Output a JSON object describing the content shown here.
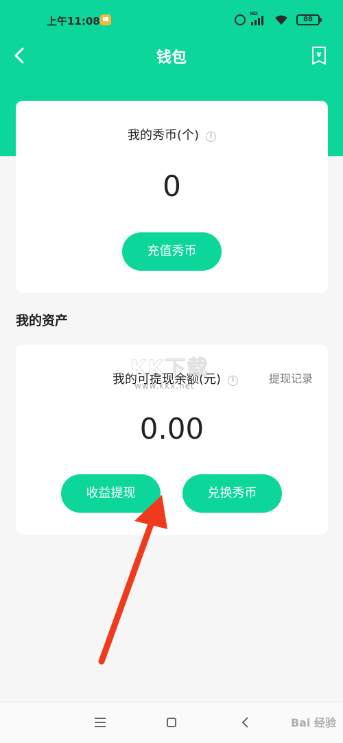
{
  "status_bar": {
    "time": "上午11:08",
    "hd": "HD",
    "battery": "88"
  },
  "header": {
    "title": "钱包",
    "back_icon": "chevron-left-icon",
    "bill_icon": "yuan-bill-icon"
  },
  "coin_card": {
    "title": "我的秀币(个)",
    "value": "0",
    "recharge_label": "充值秀币"
  },
  "assets": {
    "section_title": "我的资产",
    "balance_title": "我的可提现余额(元)",
    "record_link": "提现记录",
    "balance_value": "0.00",
    "withdraw_label": "收益提现",
    "exchange_label": "兑换秀币"
  },
  "watermark": {
    "big": "KK下载",
    "small": "www.kkx.net",
    "corner": "Bai 经验"
  },
  "colors": {
    "accent": "#0dd69a",
    "arrow": "#f03a1e",
    "background": "#f6f6f6"
  }
}
